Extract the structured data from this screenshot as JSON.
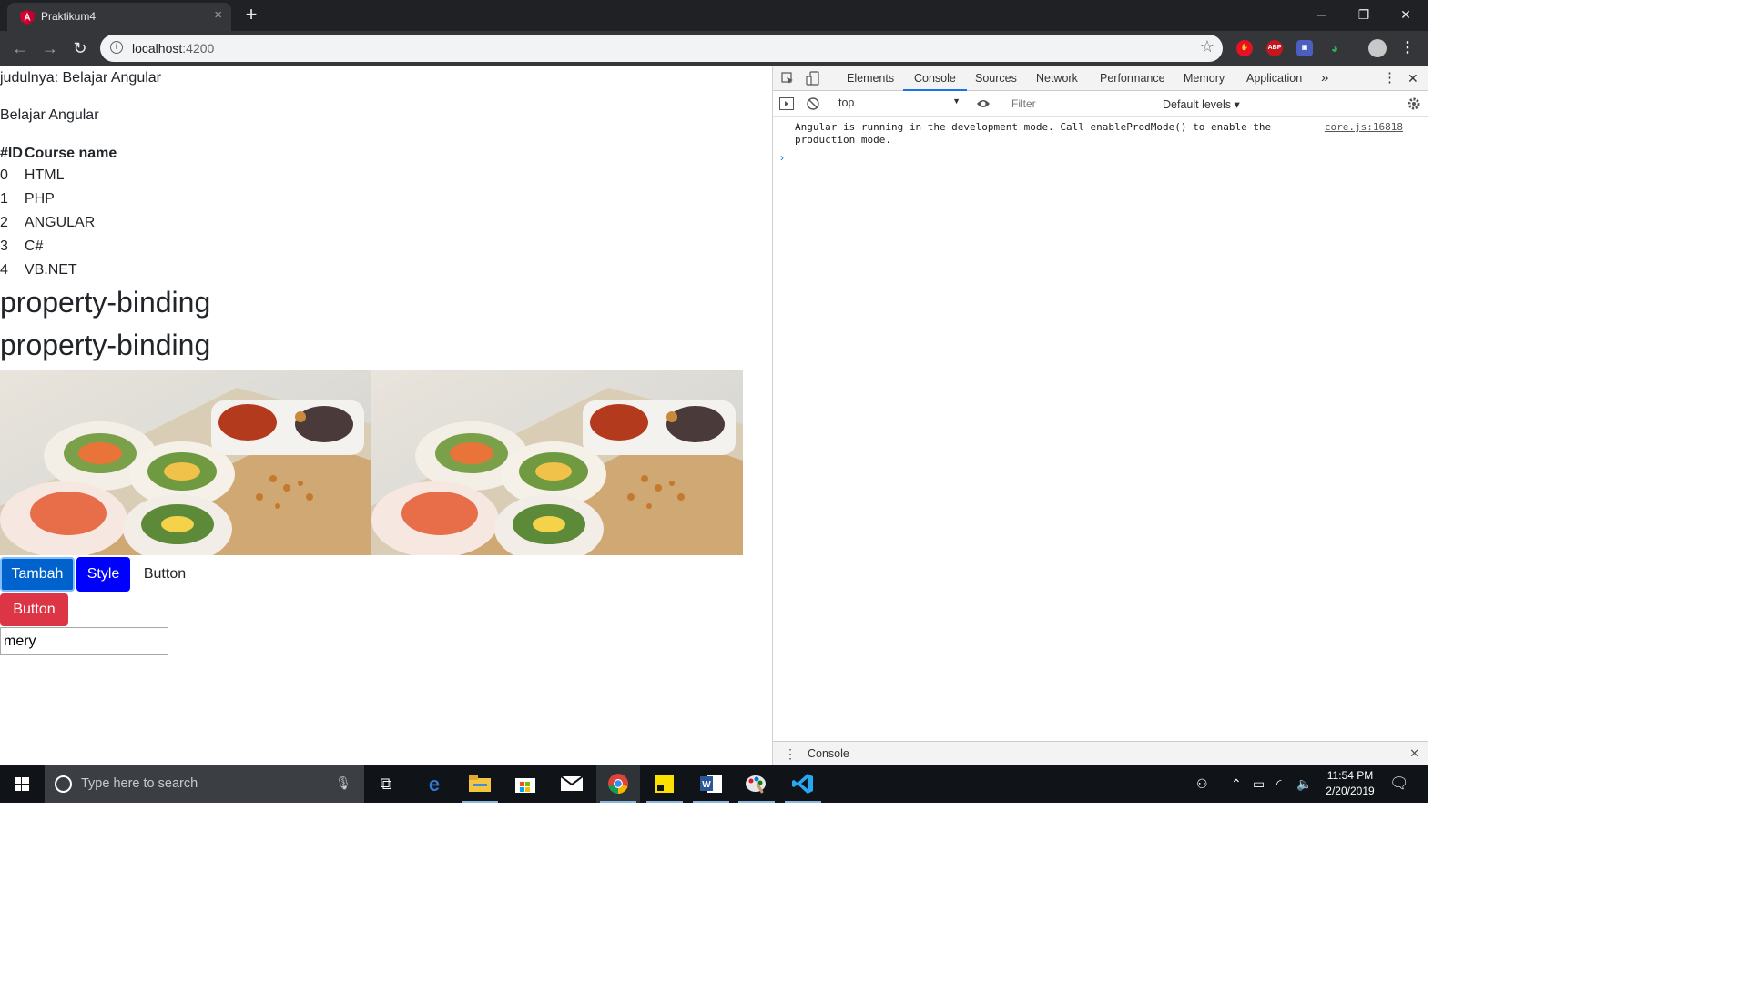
{
  "browser": {
    "tab_title": "Praktikum4",
    "tab_close": "×",
    "new_tab": "+",
    "url_host": "localhost",
    "url_port": ":4200",
    "window_controls": [
      "─",
      "❐",
      "✕"
    ]
  },
  "page": {
    "judul_text": "judulnya: Belajar Angular",
    "subtitle": "Belajar Angular",
    "table": {
      "headers": [
        "#ID",
        "Course name"
      ],
      "rows": [
        [
          "0",
          "HTML"
        ],
        [
          "1",
          "PHP"
        ],
        [
          "2",
          "ANGULAR"
        ],
        [
          "3",
          "C#"
        ],
        [
          "4",
          "VB.NET"
        ]
      ]
    },
    "heading_1": "property-binding",
    "heading_2": "property-binding",
    "buttons": {
      "tambah": "Tambah",
      "style": "Style",
      "plain": "Button",
      "danger": "Button"
    },
    "input_value": "mery"
  },
  "devtools": {
    "tabs": [
      "Elements",
      "Console",
      "Sources",
      "Network",
      "Performance",
      "Memory",
      "Application"
    ],
    "more_tabs": "»",
    "active_tab": "Console",
    "context": "top",
    "filter_placeholder": "Filter",
    "levels": "Default levels",
    "message": "Angular is running in the development mode. Call enableProdMode() to enable the production mode.",
    "message_source": "core.js:16818",
    "prompt": "›",
    "drawer_tab": "Console"
  },
  "taskbar": {
    "search_placeholder": "Type here to search",
    "time": "11:54 PM",
    "date": "2/20/2019"
  },
  "colors": {
    "primary": "#0062cc",
    "style_blue": "#0000ff",
    "danger": "#dc3545",
    "devtools_accent": "#1a73e8"
  }
}
